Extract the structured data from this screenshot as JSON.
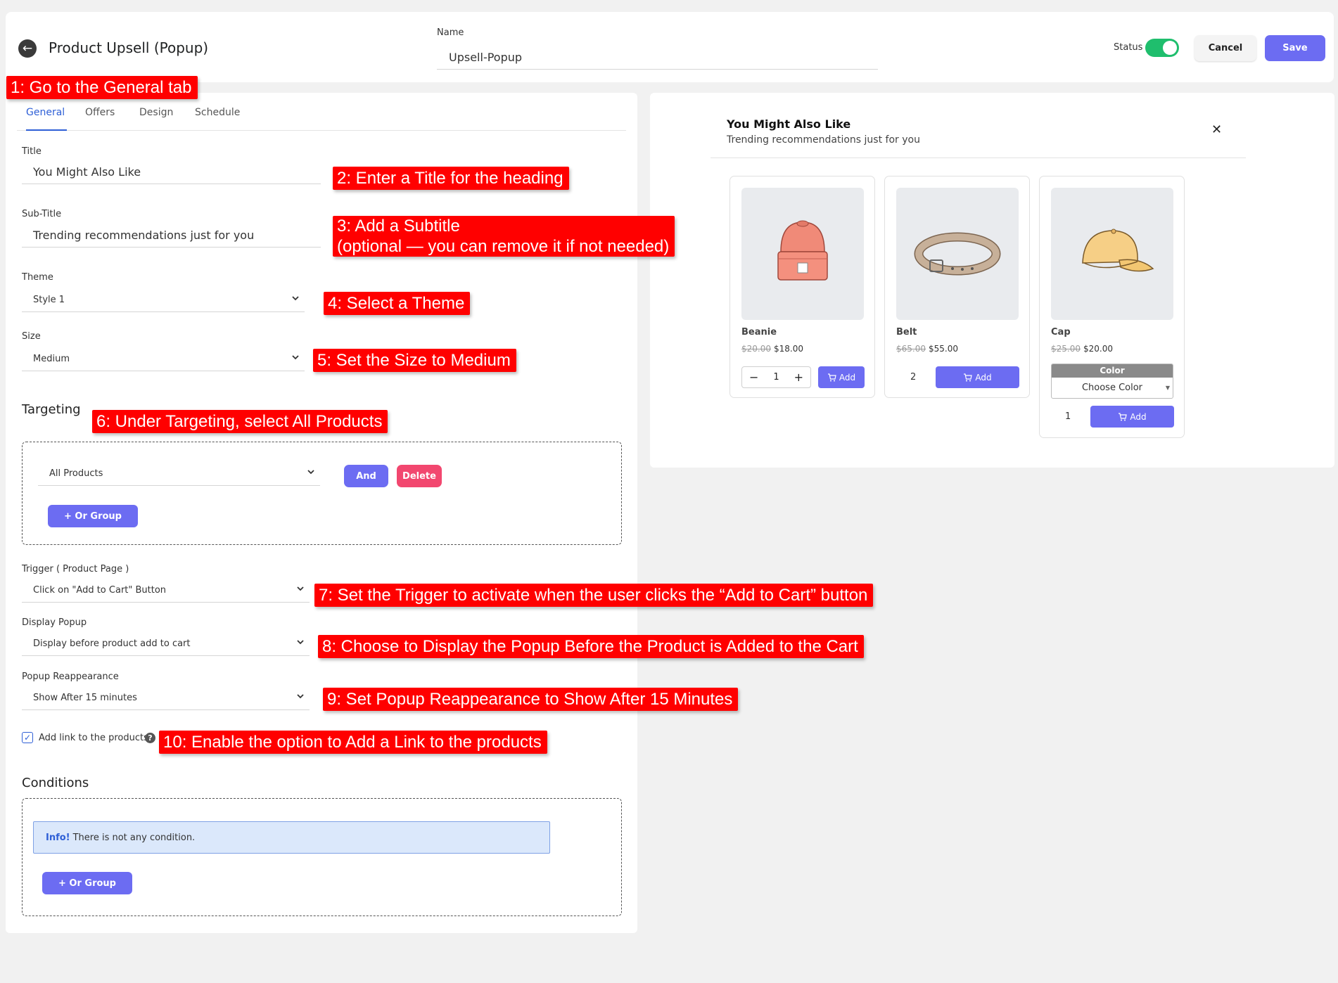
{
  "header": {
    "title": "Product Upsell (Popup)",
    "name_label": "Name",
    "name_value": "Upsell-Popup",
    "status_label": "Status",
    "status_on": true,
    "cancel_label": "Cancel",
    "save_label": "Save"
  },
  "tabs": [
    {
      "label": "General",
      "active": true
    },
    {
      "label": "Offers",
      "active": false
    },
    {
      "label": "Design",
      "active": false
    },
    {
      "label": "Schedule",
      "active": false
    }
  ],
  "general": {
    "title_label": "Title",
    "title_value": "You Might Also Like",
    "subtitle_label": "Sub-Title",
    "subtitle_value": "Trending recommendations just for you",
    "theme_label": "Theme",
    "theme_value": "Style 1",
    "size_label": "Size",
    "size_value": "Medium",
    "targeting_heading": "Targeting",
    "targeting_value": "All Products",
    "and_label": "And",
    "delete_label": "Delete",
    "or_group_label": "+ Or Group",
    "trigger_label": "Trigger ( Product Page )",
    "trigger_value": "Click on \"Add to Cart\" Button",
    "display_label": "Display Popup",
    "display_value": "Display before product add to cart",
    "reappear_label": "Popup Reappearance",
    "reappear_value": "Show After 15 minutes",
    "link_label": "Add link to the products",
    "link_checked": true,
    "conditions_heading": "Conditions",
    "info_strong": "Info!",
    "info_text": "There is not any condition.",
    "conditions_or_group_label": "+ Or Group"
  },
  "preview": {
    "title": "You Might Also Like",
    "subtitle": "Trending recommendations just for you",
    "close_glyph": "✕",
    "products": [
      {
        "name": "Beanie",
        "old_price": "$20.00",
        "price": "$18.00",
        "qty": "1",
        "add_label": "Add",
        "icon": "beanie-image"
      },
      {
        "name": "Belt",
        "old_price": "$65.00",
        "price": "$55.00",
        "qty": "2",
        "add_label": "Add",
        "icon": "belt-image"
      },
      {
        "name": "Cap",
        "old_price": "$25.00",
        "price": "$20.00",
        "qty": "1",
        "add_label": "Add",
        "icon": "cap-image",
        "color_label": "Color",
        "color_value": "Choose Color"
      }
    ]
  },
  "annotations": [
    "1: Go to the General tab",
    "2: Enter a Title for the heading",
    "3: Add a Subtitle",
    "(optional — you can remove it if not needed)",
    "4: Select a Theme",
    "5: Set the Size to Medium",
    "6: Under Targeting, select All Products",
    "7: Set the Trigger to activate when the user clicks the “Add to Cart” button",
    "8: Choose to Display the Popup Before the Product is Added to the Cart",
    "9: Set Popup Reappearance to Show After 15 Minutes",
    "10: Enable the option to Add a Link to the products"
  ],
  "colors": {
    "accent": "#6c6cf2",
    "danger": "#f2476f",
    "toggle_on": "#1fbe6d",
    "annotation": "#ff0000",
    "tab_active": "#2e5fd6"
  }
}
